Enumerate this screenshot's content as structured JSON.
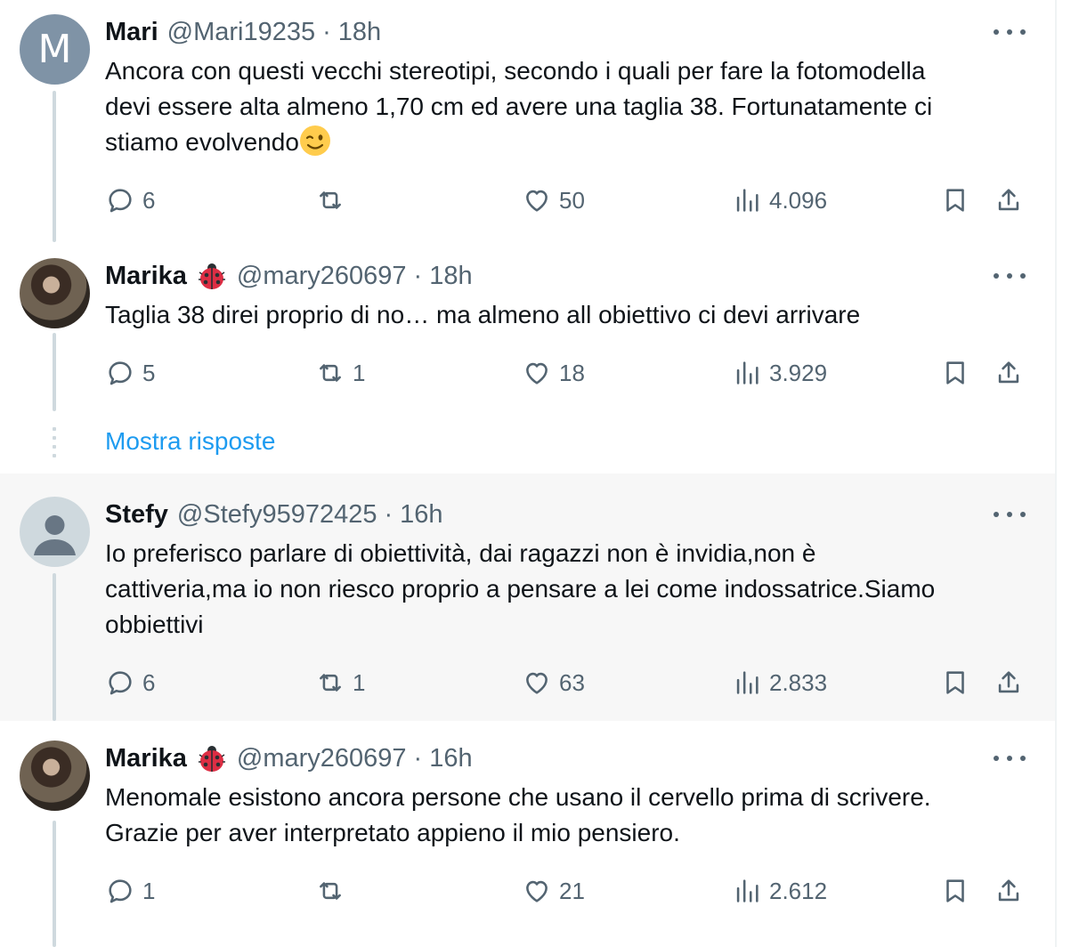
{
  "tweets": [
    {
      "name": "Mari",
      "avatar_letter": "M",
      "handle": "@Mari19235",
      "sep": "·",
      "time": "18h",
      "text_lines": [
        "Ancora con questi vecchi stereotipi, secondo i quali per fare la fotomodella",
        "devi essere alta almeno 1,70 cm ed avere una taglia 38. Fortunatamente ci",
        "stiamo evolvendo"
      ],
      "trailing_emoji": "winking-face-emoji",
      "replies": "6",
      "retweets": "",
      "likes": "50",
      "views": "4.096"
    },
    {
      "name": "Marika",
      "badge": "ladybug-emoji",
      "handle": "@mary260697",
      "sep": "·",
      "time": "18h",
      "text_lines": [
        "Taglia 38 direi proprio di no… ma almeno all obiettivo ci devi arrivare"
      ],
      "replies": "5",
      "retweets": "1",
      "likes": "18",
      "views": "3.929"
    },
    {
      "name": "Stefy",
      "handle": "@Stefy95972425",
      "sep": "·",
      "time": "16h",
      "text_lines": [
        "Io preferisco parlare di obiettività, dai ragazzi non è invidia,non è",
        "cattiveria,ma io non riesco proprio a pensare a lei come indossatrice.Siamo",
        "obbiettivi"
      ],
      "replies": "6",
      "retweets": "1",
      "likes": "63",
      "views": "2.833"
    },
    {
      "name": "Marika",
      "badge": "ladybug-emoji",
      "handle": "@mary260697",
      "sep": "·",
      "time": "16h",
      "text_lines": [
        "Menomale esistono ancora persone che usano il cervello prima di scrivere.",
        "Grazie per aver interpretato appieno il mio pensiero."
      ],
      "replies": "1",
      "retweets": "",
      "likes": "21",
      "views": "2.612"
    }
  ],
  "show_replies_label": "Mostra risposte",
  "colors": {
    "text": "#0f1419",
    "secondary": "#536471",
    "link": "#1d9bf0",
    "highlight_bg": "#f7f7f7",
    "thread_line": "#cfd9de"
  }
}
